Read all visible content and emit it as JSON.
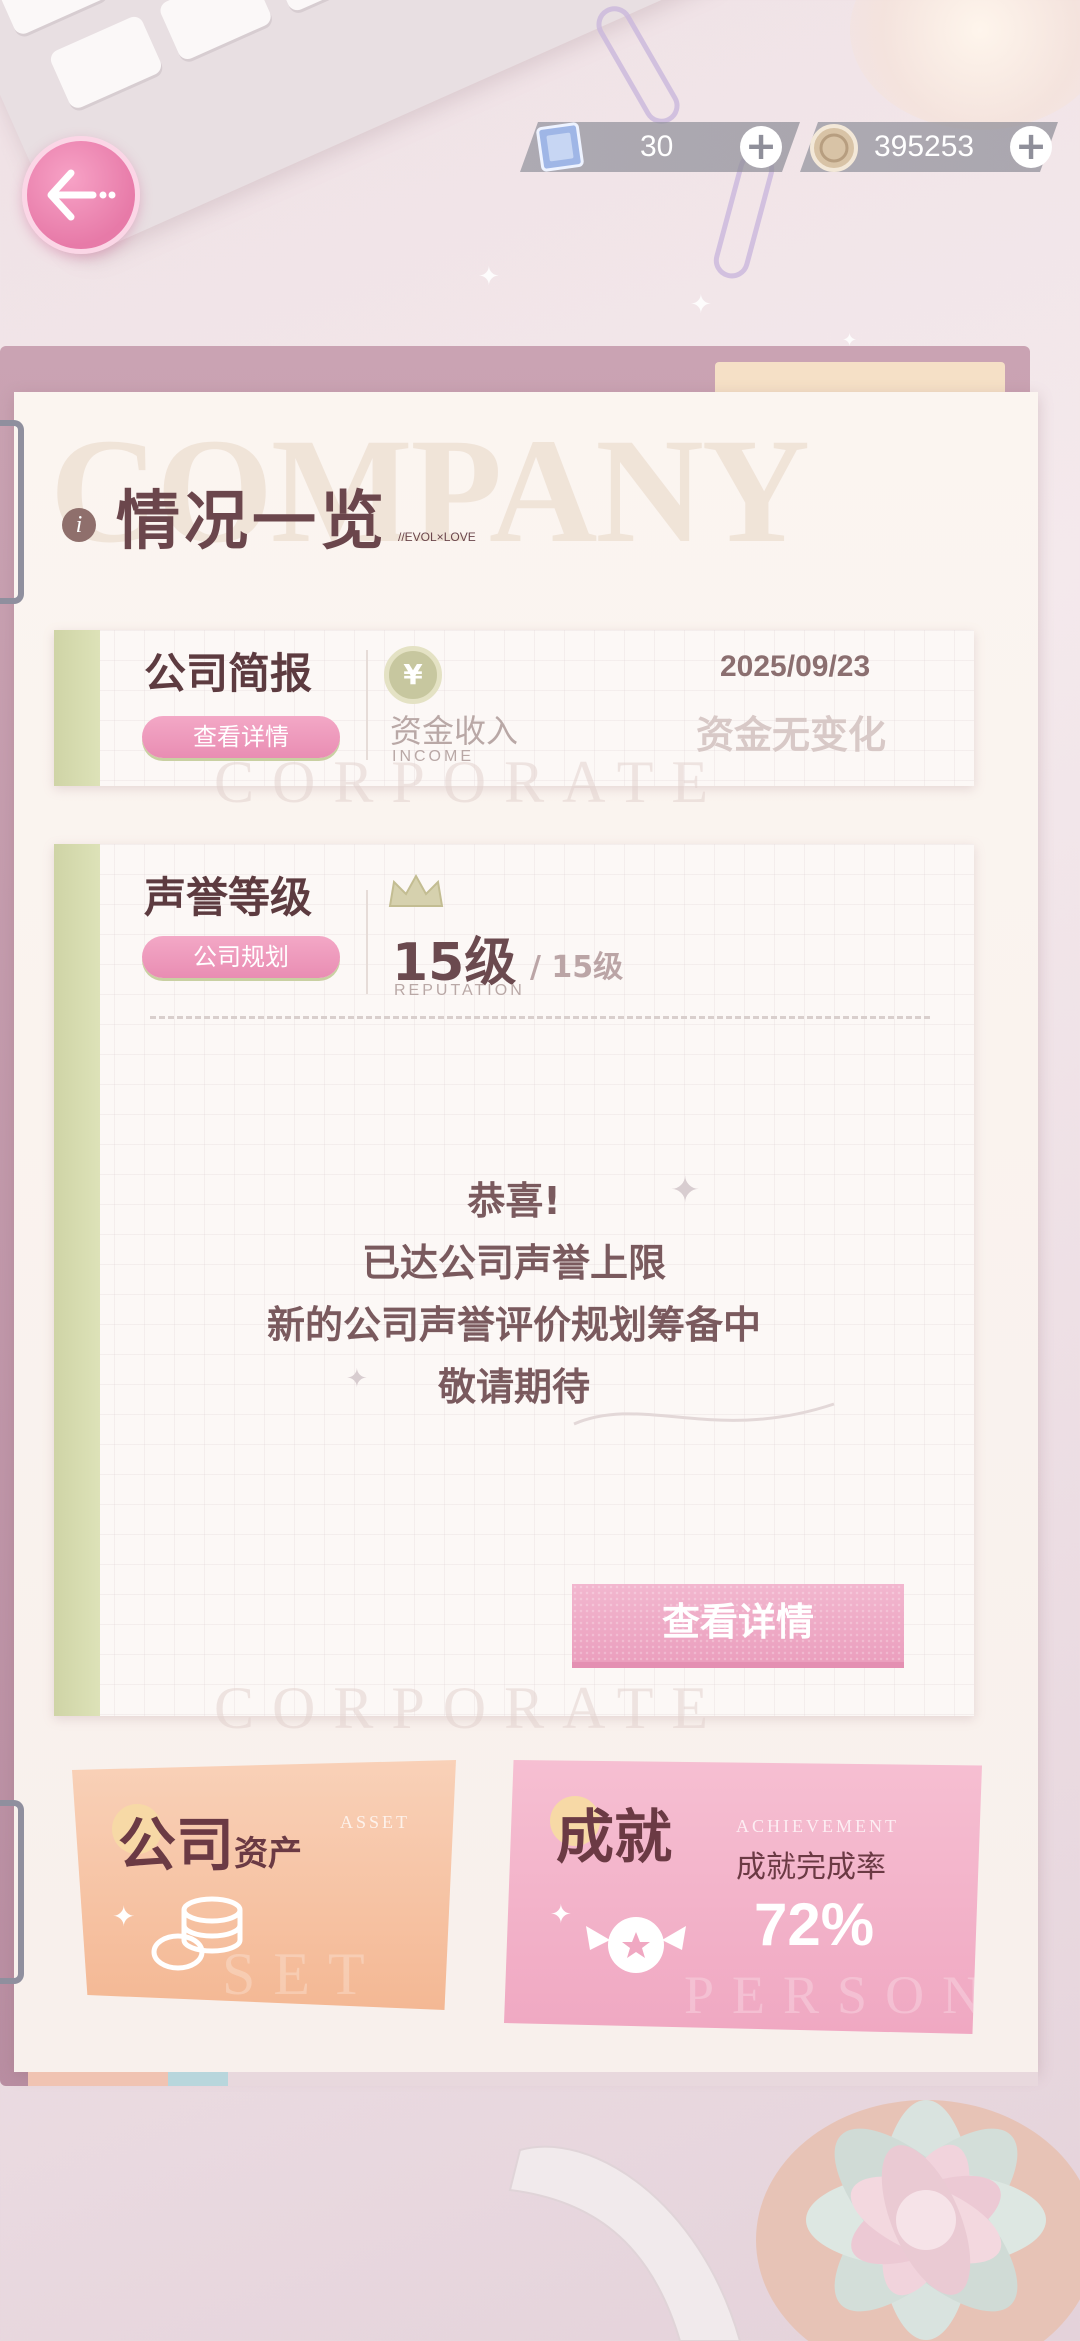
{
  "header": {
    "back_label": "返回",
    "currencies": [
      {
        "icon": "ticket-icon",
        "value": "30"
      },
      {
        "icon": "coin-icon",
        "value": "395253"
      }
    ]
  },
  "page": {
    "bg_word": "COMPANY",
    "title": "情况一览",
    "tag": "//EVOL×LOVE"
  },
  "briefing": {
    "heading_hl": "公司",
    "heading_rest": "简报",
    "button": "查看详情",
    "income_label": "资金收入",
    "income_sub": "INCOME",
    "date": "2025/09/23",
    "status": "资金无变化",
    "watermark": "CORPORATE"
  },
  "reputation": {
    "heading_hl": "声誉",
    "heading_rest": "等级",
    "button": "公司规划",
    "level": "15级",
    "level_max": "/ 15级",
    "level_sub": "REPUTATION",
    "message": [
      "恭喜!",
      "已达公司声誉上限",
      "新的公司声誉评价规划筹备中",
      "敬请期待"
    ],
    "detail_button": "查看详情",
    "watermark": "CORPORATE"
  },
  "assets": {
    "title_big": "公司",
    "title_small": "资产",
    "en": "ASSET",
    "watermark": "SET"
  },
  "achievement": {
    "title": "成就",
    "en": "ACHIEVEMENT",
    "label": "成就完成率",
    "rate": "72%",
    "watermark": "PERSONAL"
  },
  "colors": {
    "accent_pink": "#eb9fbe",
    "spine_green": "#cfd4a6",
    "text_brown": "#6b464c"
  }
}
